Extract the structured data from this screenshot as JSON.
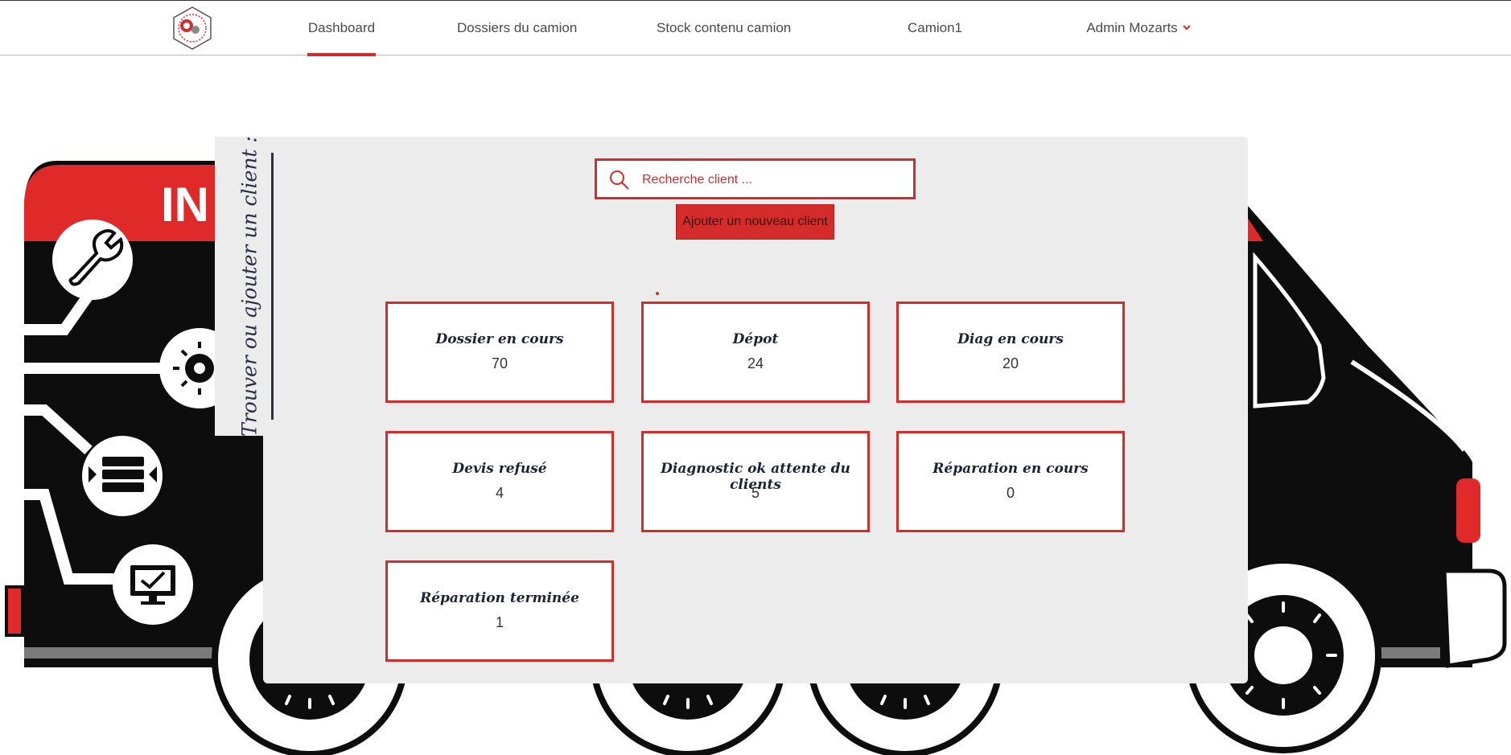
{
  "nav": {
    "dashboard": "Dashboard",
    "dossiers": "Dossiers du camion",
    "stock": "Stock contenu camion",
    "camion": "Camion1",
    "admin": "Admin Mozarts"
  },
  "van_banner_text": "IN",
  "sidebar_title": "Trouver ou ajouter un client :",
  "search": {
    "placeholder": "Recherche client ..."
  },
  "add_client_label": "Ajouter un nouveau client",
  "cards": [
    {
      "label": "Dossier en cours",
      "count": "70"
    },
    {
      "label": "Dépot",
      "count": "24"
    },
    {
      "label": "Diag en cours",
      "count": "20"
    },
    {
      "label": "Devis refusé",
      "count": "4"
    },
    {
      "label": "Diagnostic ok attente du clients",
      "count": "5"
    },
    {
      "label": "Réparation en cours",
      "count": "0"
    },
    {
      "label": "Réparation terminée",
      "count": "1"
    }
  ],
  "colors": {
    "accent": "#d42b2b",
    "panel": "#ececec",
    "van_body": "#0d0d0d",
    "title_text": "#2a2f45"
  }
}
